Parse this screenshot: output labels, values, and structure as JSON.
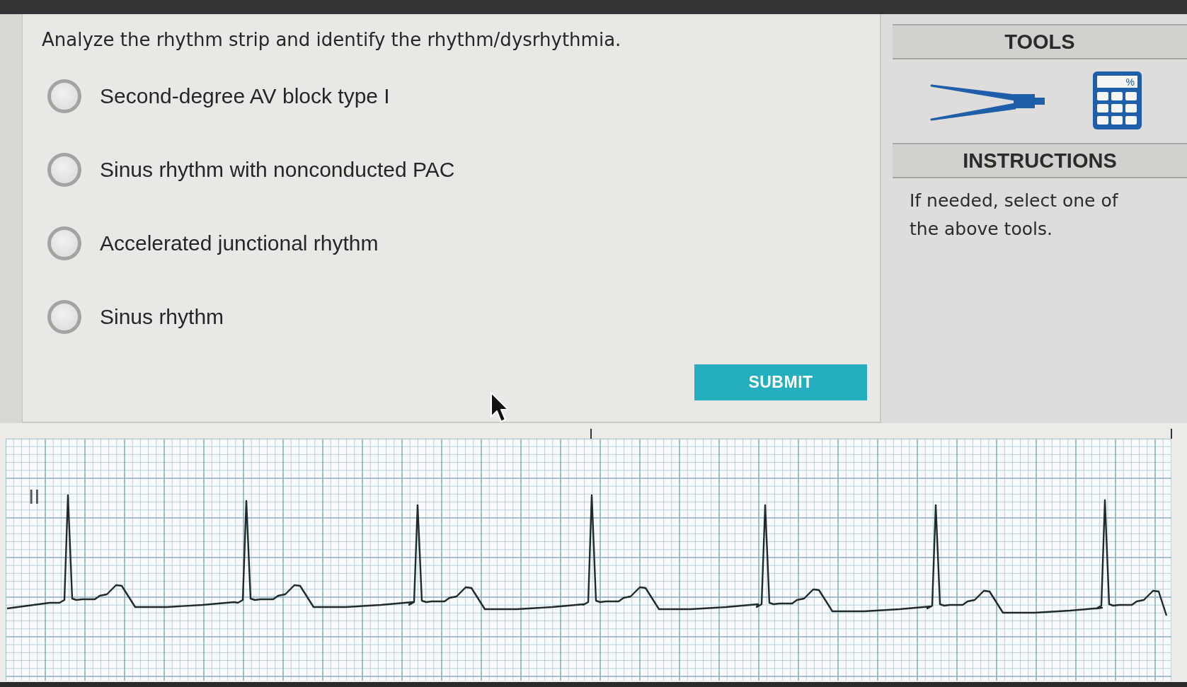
{
  "question": {
    "text": "Analyze the rhythm strip and identify the rhythm/dysrhythmia."
  },
  "options": [
    {
      "label": "Second-degree AV block type I",
      "selected": false
    },
    {
      "label": "Sinus rhythm with nonconducted PAC",
      "selected": false
    },
    {
      "label": "Accelerated junctional rhythm",
      "selected": false
    },
    {
      "label": "Sinus rhythm",
      "selected": false
    }
  ],
  "submit_button": {
    "label": "SUBMIT"
  },
  "tools_panel": {
    "title": "TOOLS",
    "tools": [
      {
        "kind": "calipers"
      },
      {
        "kind": "calculator",
        "display": "%"
      }
    ]
  },
  "instructions_panel": {
    "title": "INSTRUCTIONS",
    "text": "If needed, select one of the above tools."
  },
  "rhythm_strip": {
    "lead_label": "II"
  }
}
